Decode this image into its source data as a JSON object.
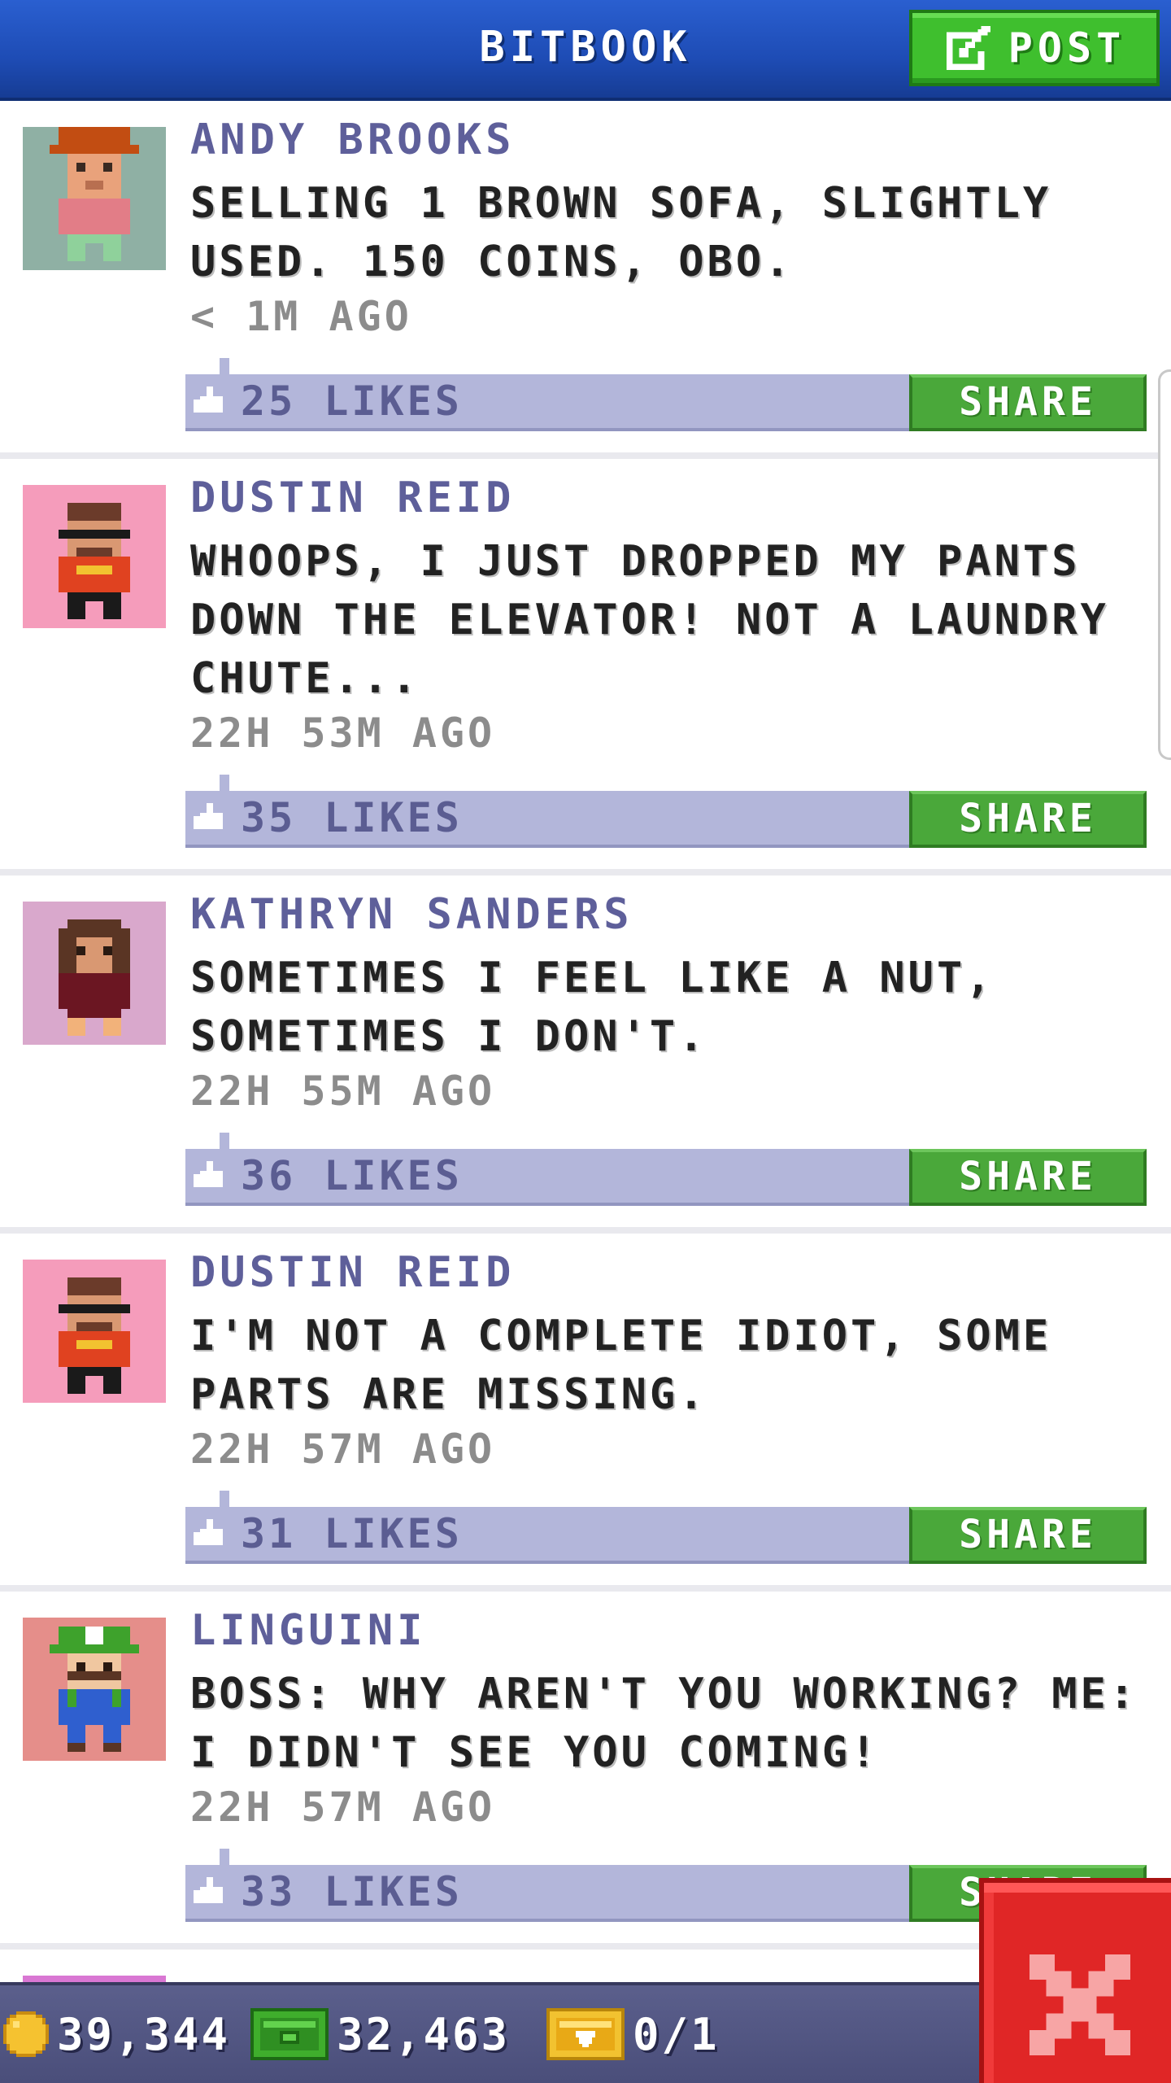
{
  "header": {
    "title": "BITBOOK",
    "post_label": "POST"
  },
  "posts": [
    {
      "author": "ANDY BROOKS",
      "message": "SELLING 1 BROWN SOFA, SLIGHTLY USED. 150 COINS, OBO.",
      "time": "< 1M AGO",
      "likes": "25 LIKES",
      "share": "SHARE",
      "avatar_bg": "#8fb0a4"
    },
    {
      "author": "DUSTIN REID",
      "message": "WHOOPS, I JUST DROPPED MY PANTS DOWN THE ELEVATOR! NOT A LAUNDRY CHUTE...",
      "time": "22H 53M AGO",
      "likes": "35 LIKES",
      "share": "SHARE",
      "avatar_bg": "#f59cbb"
    },
    {
      "author": "KATHRYN SANDERS",
      "message": "SOMETIMES I FEEL LIKE A NUT, SOMETIMES I DON'T.",
      "time": "22H 55M AGO",
      "likes": "36 LIKES",
      "share": "SHARE",
      "avatar_bg": "#d9a8cc"
    },
    {
      "author": "DUSTIN REID",
      "message": "I'M NOT A COMPLETE IDIOT, SOME PARTS ARE MISSING.",
      "time": "22H 57M AGO",
      "likes": "31 LIKES",
      "share": "SHARE",
      "avatar_bg": "#f59cbb"
    },
    {
      "author": "LINGUINI",
      "message": "BOSS: WHY AREN'T YOU WORKING? ME: I DIDN'T SEE YOU COMING!",
      "time": "22H 57M AGO",
      "likes": "33 LIKES",
      "share": "SHARE",
      "avatar_bg": "#e58e8a"
    }
  ],
  "status_bar": {
    "coins": "39,344",
    "bux": "32,463",
    "tickets": "0/1"
  },
  "icons": {
    "post": "edit-icon",
    "like": "thumbs-up-icon",
    "coins": "coin-icon",
    "bux": "bux-icon",
    "tickets": "ticket-icon",
    "close": "close-icon"
  },
  "colors": {
    "header_blue": "#1e4cb5",
    "accent_green": "#3fbf2e",
    "author_purple": "#5e5f9a",
    "like_bar": "#b3b6da",
    "close_red": "#e02626"
  }
}
